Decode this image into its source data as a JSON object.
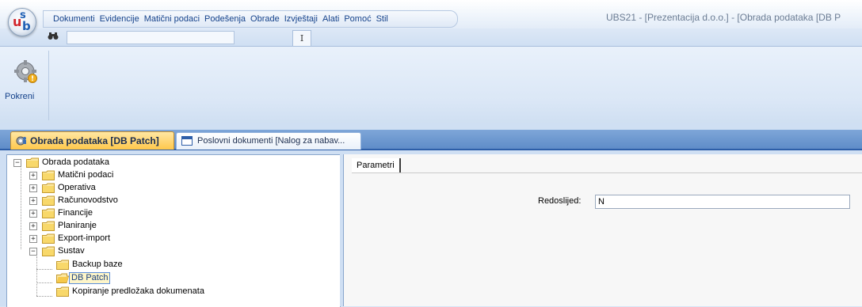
{
  "app": {
    "logo_letters": {
      "u": "u",
      "s": "s",
      "b": "b"
    },
    "window_title": "UBS21 - [Prezentacija d.o.o.] - [Obrada podataka [DB P"
  },
  "menu": [
    "Dokumenti",
    "Evidencije",
    "Matični podaci",
    "Podešenja",
    "Obrade",
    "Izvještaji",
    "Alati",
    "Pomoć",
    "Stil"
  ],
  "quick_access": {
    "search_value": "",
    "search_icon": "binoculars-icon"
  },
  "ribbon": {
    "tab_label": "I",
    "run_button": {
      "label": "Pokreni",
      "icon": "gear-run-icon"
    }
  },
  "document_tabs": [
    {
      "label": "Obrada podataka [DB Patch]",
      "active": true,
      "icon": "gear-users-icon"
    },
    {
      "label": "Poslovni dokumenti [Nalog za nabav...",
      "active": false,
      "icon": "window-icon"
    }
  ],
  "tree": [
    {
      "label": "Obrada podataka",
      "expander": "−"
    },
    {
      "label": "Matični podaci",
      "expander": "+"
    },
    {
      "label": "Operativa",
      "expander": "+"
    },
    {
      "label": "Računovodstvo",
      "expander": "+"
    },
    {
      "label": "Financije",
      "expander": "+"
    },
    {
      "label": "Planiranje",
      "expander": "+"
    },
    {
      "label": "Export-import",
      "expander": "+"
    },
    {
      "label": "Sustav",
      "expander": "−"
    },
    {
      "label": "Backup baze",
      "expander": ""
    },
    {
      "label": "DB Patch",
      "expander": "",
      "selected": true
    },
    {
      "label": "Kopiranje predložaka dokumenata",
      "expander": ""
    }
  ],
  "parameters": {
    "tab_label": "Parametri",
    "field_label": "Redoslijed:",
    "field_value": "N"
  },
  "colors": {
    "accent": "#2d5ea8",
    "active_tab": "#ffc84b",
    "selection": "#fdf5c9"
  }
}
